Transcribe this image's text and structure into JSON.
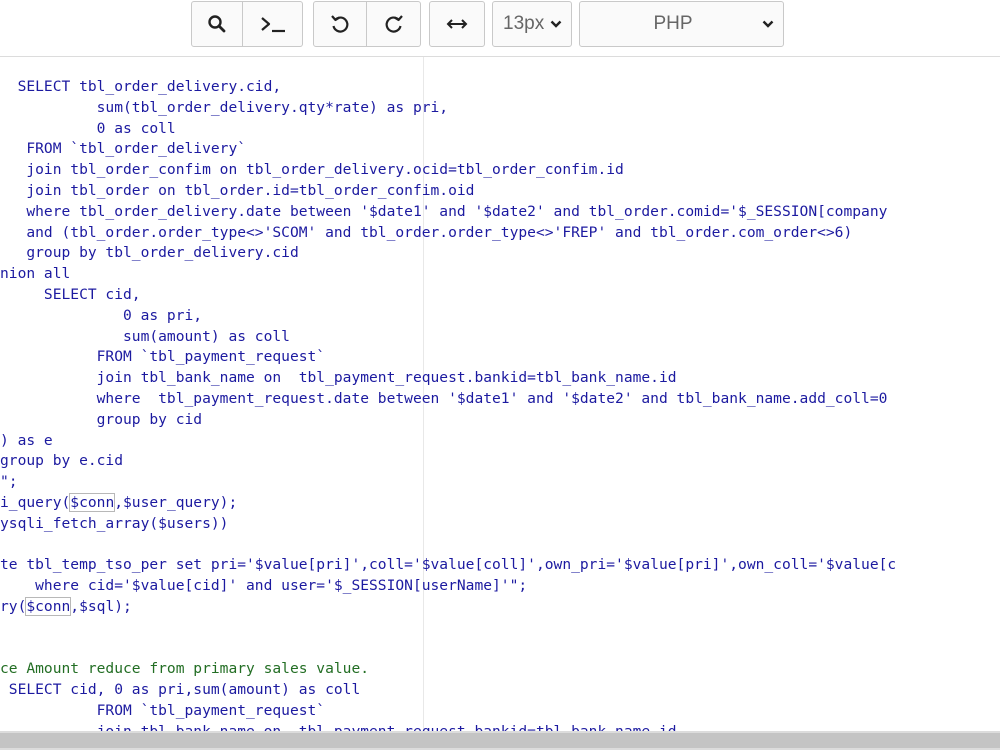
{
  "toolbar": {
    "buttons": [
      {
        "icon": "search-icon"
      },
      {
        "icon": "console-icon"
      },
      {
        "icon": "undo-icon"
      },
      {
        "icon": "redo-icon"
      },
      {
        "icon": "wrap-toggle-icon"
      }
    ],
    "font_size": "13px",
    "language": "PHP"
  },
  "editor": {
    "colors": {
      "code": "#1c1aa0",
      "comment": "#236e24",
      "background": "#ffffff"
    },
    "lines": [
      "  SELECT tbl_order_delivery.cid,",
      "           sum(tbl_order_delivery.qty*rate) as pri,",
      "           0 as coll",
      "   FROM `tbl_order_delivery`",
      "   join tbl_order_confim on tbl_order_delivery.ocid=tbl_order_confim.id",
      "   join tbl_order on tbl_order.id=tbl_order_confim.oid",
      "   where tbl_order_delivery.date between '$date1' and '$date2' and tbl_order.comid='$_SESSION[company",
      "   and (tbl_order.order_type<>'SCOM' and tbl_order.order_type<>'FREP' and tbl_order.com_order<>6)",
      "   group by tbl_order_delivery.cid",
      "nion all",
      "     SELECT cid,",
      "              0 as pri,",
      "              sum(amount) as coll",
      "           FROM `tbl_payment_request`",
      "           join tbl_bank_name on  tbl_payment_request.bankid=tbl_bank_name.id",
      "           where  tbl_payment_request.date between '$date1' and '$date2' and tbl_bank_name.add_coll=0",
      "           group by cid",
      ") as e",
      "group by e.cid",
      "\";",
      "i_query($conn,$user_query);",
      "ysqli_fetch_array($users))",
      "",
      "te tbl_temp_tso_per set pri='$value[pri]',coll='$value[coll]',own_pri='$value[pri]',own_coll='$value[c",
      "    where cid='$value[cid]' and user='$_SESSION[userName]'\";",
      "ry($conn,$sql);",
      "",
      "",
      "ce Amount reduce from primary sales value.",
      " SELECT cid, 0 as pri,sum(amount) as coll",
      "           FROM `tbl_payment_request`",
      "           join tbl_bank_name on  tbl_payment_request.bankid=tbl_bank_name.id"
    ],
    "comment_lines": [
      28
    ]
  }
}
